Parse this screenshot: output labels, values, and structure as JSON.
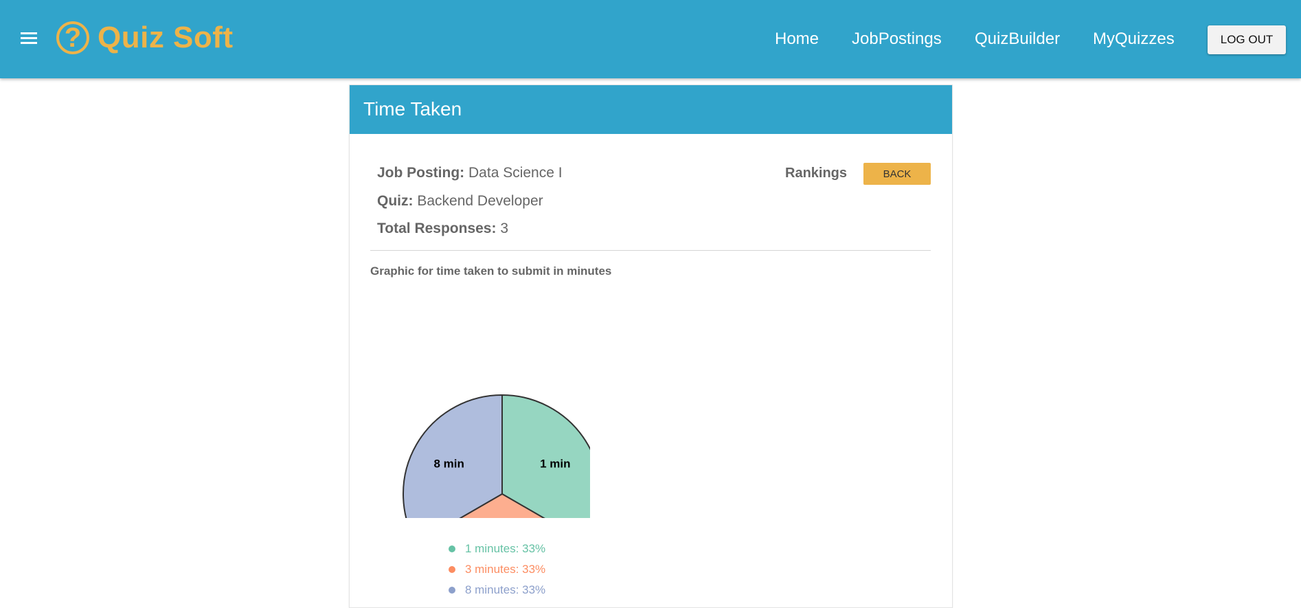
{
  "app": {
    "name": "Quiz Soft",
    "logo_glyph": "?"
  },
  "nav": {
    "items": [
      {
        "label": "Home"
      },
      {
        "label": "JobPostings"
      },
      {
        "label": "QuizBuilder"
      },
      {
        "label": "MyQuizzes"
      }
    ],
    "logout_label": "LOG OUT"
  },
  "card": {
    "title": "Time Taken",
    "job_posting_label": "Job Posting:",
    "job_posting_value": "Data Science I",
    "quiz_label": "Quiz:",
    "quiz_value": "Backend Developer",
    "total_label": "Total Responses:",
    "total_value": "3",
    "rankings_label": "Rankings",
    "back_label": "BACK",
    "chart_caption": "Graphic for time taken to submit in minutes"
  },
  "colors": {
    "header_bg": "#31a4cb",
    "accent": "#edb349",
    "slice_1": "#96d6c1",
    "slice_3": "#fdae8f",
    "slice_8": "#afbddd",
    "legend_1": "#66c2a5",
    "legend_3": "#fc8d62",
    "legend_8": "#8da0cb"
  },
  "chart_data": {
    "type": "pie",
    "title": "",
    "categories": [
      "1 min",
      "3 min",
      "8 min"
    ],
    "values": [
      33.33,
      33.33,
      33.33
    ],
    "legend": [
      {
        "label": "1 minutes: 33%"
      },
      {
        "label": "3 minutes: 33%"
      },
      {
        "label": "8 minutes: 33%"
      }
    ]
  }
}
